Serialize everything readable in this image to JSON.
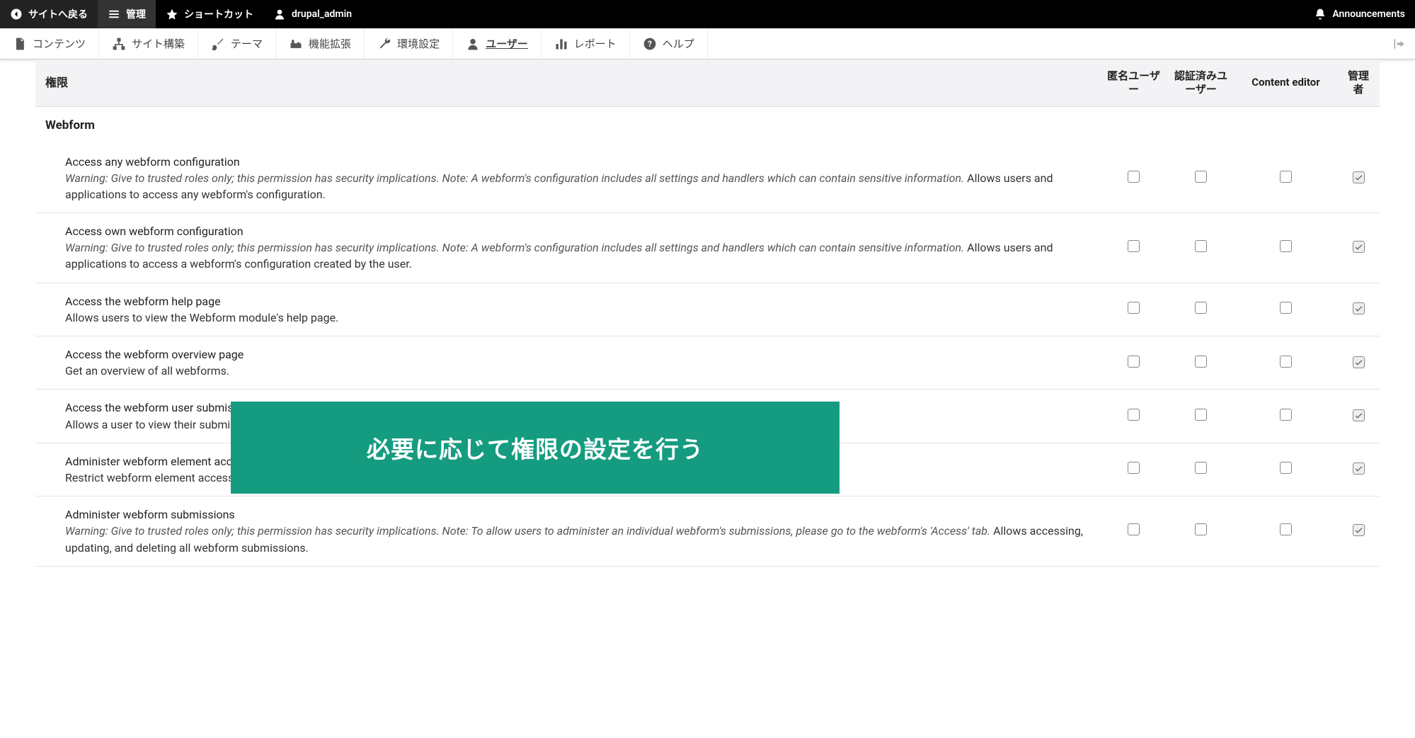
{
  "toolbar": {
    "back": "サイトへ戻る",
    "manage": "管理",
    "shortcuts": "ショートカット",
    "user": "drupal_admin",
    "announcements": "Announcements"
  },
  "admin_tabs": {
    "content": "コンテンツ",
    "structure": "サイト構築",
    "theme": "テーマ",
    "extend": "機能拡張",
    "config": "環境設定",
    "people": "ユーザー",
    "report": "レポート",
    "help": "ヘルプ"
  },
  "table": {
    "header_perm": "権限",
    "roles": {
      "anon": "匿名ユーザー",
      "auth": "認証済みユーザー",
      "editor": "Content editor",
      "admin": "管理者"
    },
    "module": "Webform",
    "rows": [
      {
        "title": "Access any webform configuration",
        "warning": "Warning: Give to trusted roles only; this permission has security implications. Note: A webform's configuration includes all settings and handlers which can contain sensitive information.",
        "desc": " Allows users and applications to access any webform's configuration.",
        "checks": [
          false,
          false,
          false,
          true
        ]
      },
      {
        "title": "Access own webform configuration",
        "warning": "Warning: Give to trusted roles only; this permission has security implications. Note: A webform's configuration includes all settings and handlers which can contain sensitive information.",
        "desc": " Allows users and applications to access a webform's configuration created by the user.",
        "checks": [
          false,
          false,
          false,
          true
        ]
      },
      {
        "title": "Access the webform help page",
        "warning": "",
        "desc": "Allows users to view the Webform module's help page.",
        "checks": [
          false,
          false,
          false,
          true
        ]
      },
      {
        "title": "Access the webform overview page",
        "warning": "",
        "desc": "Get an overview of all webforms.",
        "checks": [
          false,
          false,
          false,
          true
        ]
      },
      {
        "title": "Access the webform user submissions page",
        "warning": "",
        "desc": "Allows a user to view their submissions.",
        "checks": [
          false,
          false,
          false,
          true
        ]
      },
      {
        "title": "Administer webform element access",
        "warning": "",
        "desc": "Restrict webform element access to certain roles and users.",
        "checks": [
          false,
          false,
          false,
          true
        ]
      },
      {
        "title": "Administer webform submissions",
        "warning": "Warning: Give to trusted roles only; this permission has security implications. Note: To allow users to administer an individual webform's submissions, please go to the webform's 'Access' tab.",
        "desc": " Allows accessing, updating, and deleting all webform submissions.",
        "checks": [
          false,
          false,
          false,
          true
        ]
      }
    ]
  },
  "banner": "必要に応じて権限の設定を行う"
}
